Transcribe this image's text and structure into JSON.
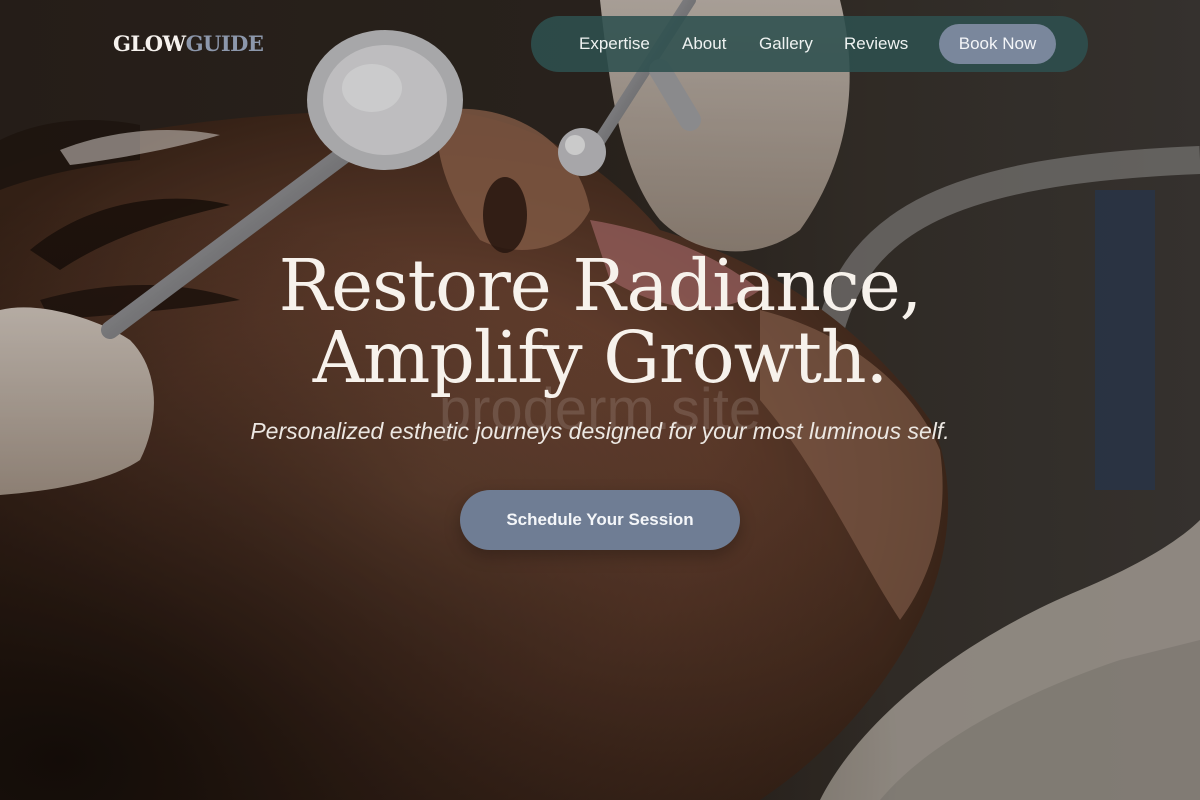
{
  "brand": {
    "logo_part1": "GLOW",
    "logo_part2": "GUIDE"
  },
  "nav": {
    "items": [
      {
        "label": "Expertise"
      },
      {
        "label": "About"
      },
      {
        "label": "Gallery"
      },
      {
        "label": "Reviews"
      }
    ],
    "cta_label": "Book Now"
  },
  "hero": {
    "headline_line1": "Restore Radiance,",
    "headline_line2": "Amplify Growth.",
    "watermark": "proderm.site",
    "subheadline": "Personalized esthetic journeys designed for your most luminous self.",
    "cta_label": "Schedule Your Session",
    "image": "facial-treatment-photo"
  },
  "colors": {
    "nav_bg": "#2e504e",
    "button_bg": "#7a879c",
    "logo_accent": "#8c97ab",
    "text_light": "#f7f2ec"
  }
}
